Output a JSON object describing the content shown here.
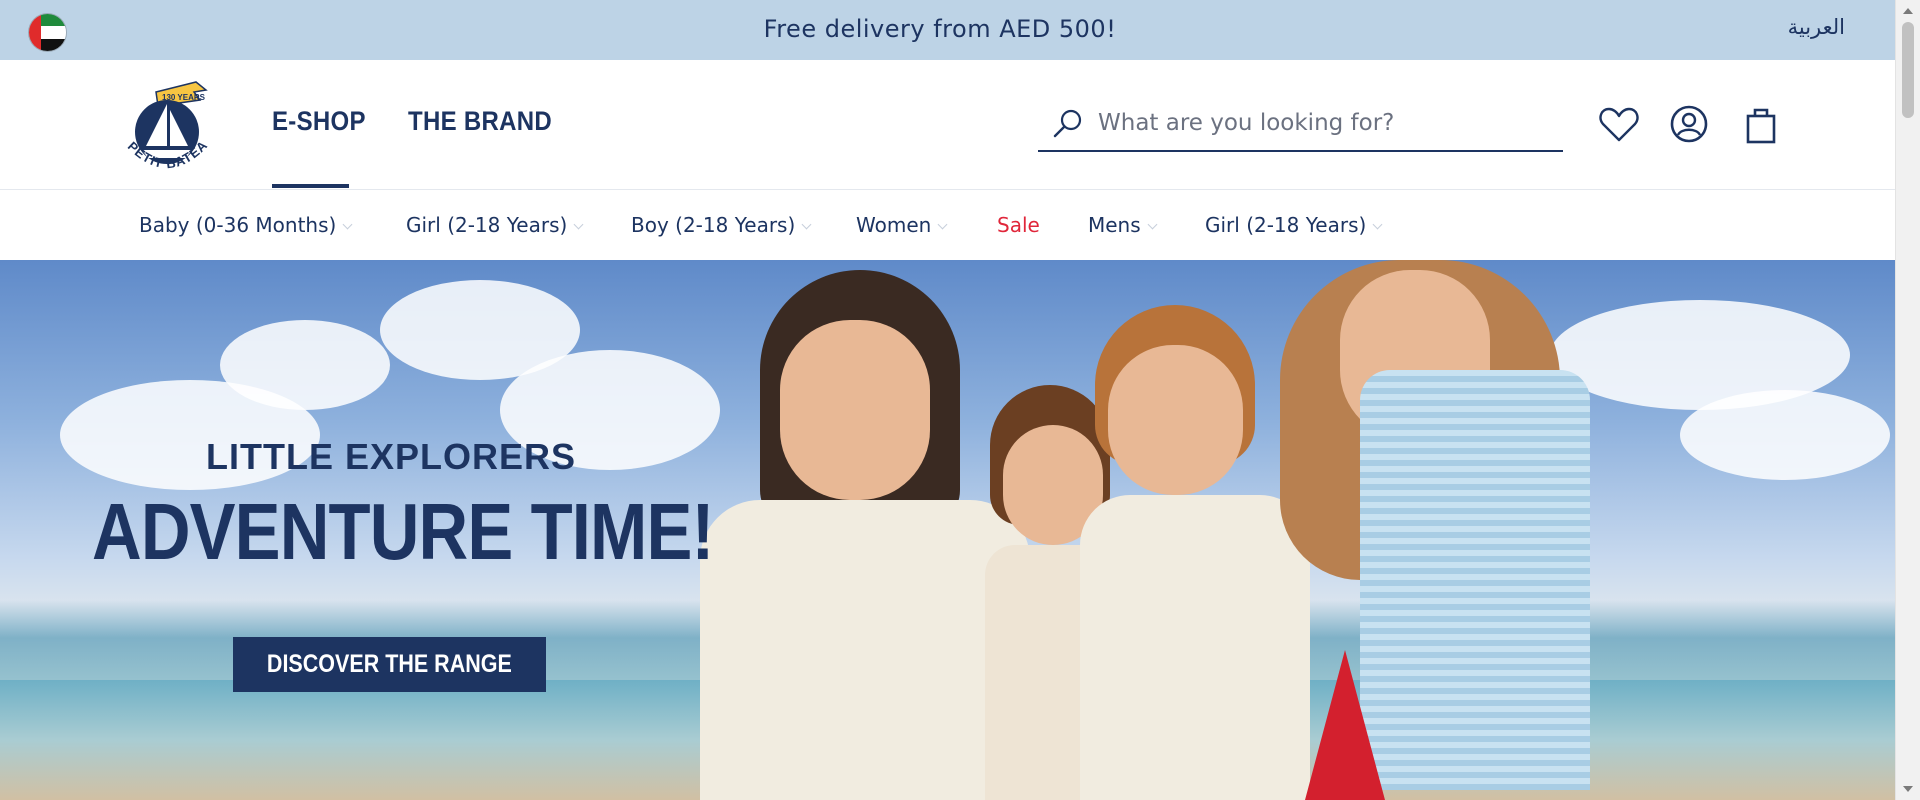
{
  "top_banner": {
    "promo_text": "Free delivery from AED 500!",
    "language_link": "العربية",
    "flag_icon": "uae-flag-icon"
  },
  "header": {
    "logo": {
      "brand_text": "PETIT BATEAU",
      "badge_text": "130 YEARS"
    },
    "main_nav": [
      {
        "label": "E-SHOP",
        "active": true
      },
      {
        "label": "THE BRAND",
        "active": false
      }
    ],
    "search": {
      "placeholder": "What are you looking for?",
      "value": "",
      "icon": "search-icon"
    },
    "icons": [
      "heart-icon",
      "user-account-icon",
      "shopping-bag-icon"
    ]
  },
  "categories": [
    {
      "label": "Baby (0-36 Months)",
      "has_dropdown": true
    },
    {
      "label": "Girl (2-18 Years)",
      "has_dropdown": true
    },
    {
      "label": "Boy (2-18 Years)",
      "has_dropdown": true
    },
    {
      "label": "Women",
      "has_dropdown": true
    },
    {
      "label": "Sale",
      "has_dropdown": false
    },
    {
      "label": "Mens",
      "has_dropdown": true
    },
    {
      "label": "Girl (2-18 Years)",
      "has_dropdown": true
    }
  ],
  "hero": {
    "subtitle": "LITTLE EXPLORERS",
    "title": "ADVENTURE TIME!",
    "cta_label": "DISCOVER THE RANGE"
  },
  "colors": {
    "navy": "#1d3461",
    "banner_bg": "#bdd3e6",
    "sale_red": "#e0263a"
  }
}
